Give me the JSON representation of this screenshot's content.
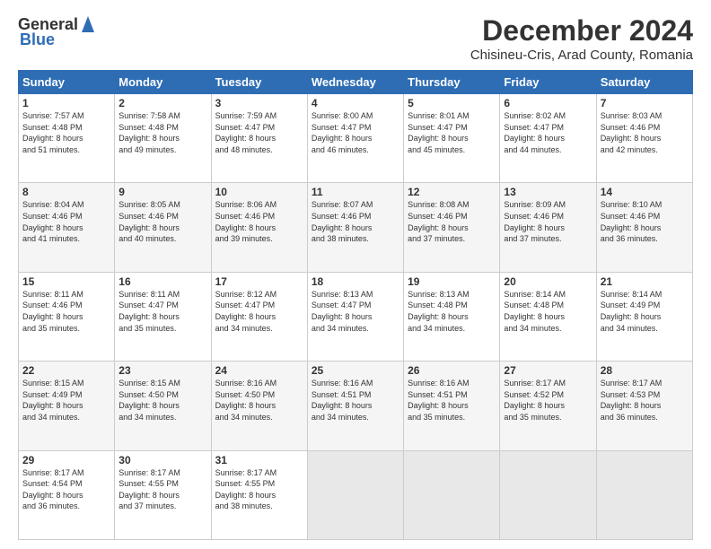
{
  "header": {
    "logo_general": "General",
    "logo_blue": "Blue",
    "main_title": "December 2024",
    "subtitle": "Chisineu-Cris, Arad County, Romania"
  },
  "days_of_week": [
    "Sunday",
    "Monday",
    "Tuesday",
    "Wednesday",
    "Thursday",
    "Friday",
    "Saturday"
  ],
  "weeks": [
    [
      {
        "day": "1",
        "info": "Sunrise: 7:57 AM\nSunset: 4:48 PM\nDaylight: 8 hours\nand 51 minutes."
      },
      {
        "day": "2",
        "info": "Sunrise: 7:58 AM\nSunset: 4:48 PM\nDaylight: 8 hours\nand 49 minutes."
      },
      {
        "day": "3",
        "info": "Sunrise: 7:59 AM\nSunset: 4:47 PM\nDaylight: 8 hours\nand 48 minutes."
      },
      {
        "day": "4",
        "info": "Sunrise: 8:00 AM\nSunset: 4:47 PM\nDaylight: 8 hours\nand 46 minutes."
      },
      {
        "day": "5",
        "info": "Sunrise: 8:01 AM\nSunset: 4:47 PM\nDaylight: 8 hours\nand 45 minutes."
      },
      {
        "day": "6",
        "info": "Sunrise: 8:02 AM\nSunset: 4:47 PM\nDaylight: 8 hours\nand 44 minutes."
      },
      {
        "day": "7",
        "info": "Sunrise: 8:03 AM\nSunset: 4:46 PM\nDaylight: 8 hours\nand 42 minutes."
      }
    ],
    [
      {
        "day": "8",
        "info": "Sunrise: 8:04 AM\nSunset: 4:46 PM\nDaylight: 8 hours\nand 41 minutes."
      },
      {
        "day": "9",
        "info": "Sunrise: 8:05 AM\nSunset: 4:46 PM\nDaylight: 8 hours\nand 40 minutes."
      },
      {
        "day": "10",
        "info": "Sunrise: 8:06 AM\nSunset: 4:46 PM\nDaylight: 8 hours\nand 39 minutes."
      },
      {
        "day": "11",
        "info": "Sunrise: 8:07 AM\nSunset: 4:46 PM\nDaylight: 8 hours\nand 38 minutes."
      },
      {
        "day": "12",
        "info": "Sunrise: 8:08 AM\nSunset: 4:46 PM\nDaylight: 8 hours\nand 37 minutes."
      },
      {
        "day": "13",
        "info": "Sunrise: 8:09 AM\nSunset: 4:46 PM\nDaylight: 8 hours\nand 37 minutes."
      },
      {
        "day": "14",
        "info": "Sunrise: 8:10 AM\nSunset: 4:46 PM\nDaylight: 8 hours\nand 36 minutes."
      }
    ],
    [
      {
        "day": "15",
        "info": "Sunrise: 8:11 AM\nSunset: 4:46 PM\nDaylight: 8 hours\nand 35 minutes."
      },
      {
        "day": "16",
        "info": "Sunrise: 8:11 AM\nSunset: 4:47 PM\nDaylight: 8 hours\nand 35 minutes."
      },
      {
        "day": "17",
        "info": "Sunrise: 8:12 AM\nSunset: 4:47 PM\nDaylight: 8 hours\nand 34 minutes."
      },
      {
        "day": "18",
        "info": "Sunrise: 8:13 AM\nSunset: 4:47 PM\nDaylight: 8 hours\nand 34 minutes."
      },
      {
        "day": "19",
        "info": "Sunrise: 8:13 AM\nSunset: 4:48 PM\nDaylight: 8 hours\nand 34 minutes."
      },
      {
        "day": "20",
        "info": "Sunrise: 8:14 AM\nSunset: 4:48 PM\nDaylight: 8 hours\nand 34 minutes."
      },
      {
        "day": "21",
        "info": "Sunrise: 8:14 AM\nSunset: 4:49 PM\nDaylight: 8 hours\nand 34 minutes."
      }
    ],
    [
      {
        "day": "22",
        "info": "Sunrise: 8:15 AM\nSunset: 4:49 PM\nDaylight: 8 hours\nand 34 minutes."
      },
      {
        "day": "23",
        "info": "Sunrise: 8:15 AM\nSunset: 4:50 PM\nDaylight: 8 hours\nand 34 minutes."
      },
      {
        "day": "24",
        "info": "Sunrise: 8:16 AM\nSunset: 4:50 PM\nDaylight: 8 hours\nand 34 minutes."
      },
      {
        "day": "25",
        "info": "Sunrise: 8:16 AM\nSunset: 4:51 PM\nDaylight: 8 hours\nand 34 minutes."
      },
      {
        "day": "26",
        "info": "Sunrise: 8:16 AM\nSunset: 4:51 PM\nDaylight: 8 hours\nand 35 minutes."
      },
      {
        "day": "27",
        "info": "Sunrise: 8:17 AM\nSunset: 4:52 PM\nDaylight: 8 hours\nand 35 minutes."
      },
      {
        "day": "28",
        "info": "Sunrise: 8:17 AM\nSunset: 4:53 PM\nDaylight: 8 hours\nand 36 minutes."
      }
    ],
    [
      {
        "day": "29",
        "info": "Sunrise: 8:17 AM\nSunset: 4:54 PM\nDaylight: 8 hours\nand 36 minutes."
      },
      {
        "day": "30",
        "info": "Sunrise: 8:17 AM\nSunset: 4:55 PM\nDaylight: 8 hours\nand 37 minutes."
      },
      {
        "day": "31",
        "info": "Sunrise: 8:17 AM\nSunset: 4:55 PM\nDaylight: 8 hours\nand 38 minutes."
      },
      {
        "day": "",
        "info": ""
      },
      {
        "day": "",
        "info": ""
      },
      {
        "day": "",
        "info": ""
      },
      {
        "day": "",
        "info": ""
      }
    ]
  ]
}
